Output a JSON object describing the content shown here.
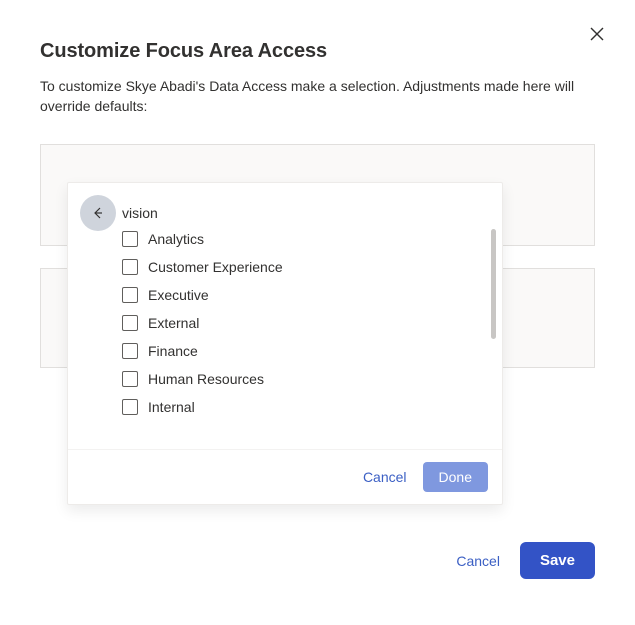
{
  "dialog": {
    "title": "Customize Focus Area Access",
    "subtitle": "To customize Skye Abadi's Data Access make a selection. Adjustments made here will override defaults:",
    "cancel_label": "Cancel",
    "save_label": "Save"
  },
  "popover": {
    "group_label_fragment": "vision",
    "options": [
      {
        "label": "Analytics",
        "checked": false
      },
      {
        "label": "Customer Experience",
        "checked": false
      },
      {
        "label": "Executive",
        "checked": false
      },
      {
        "label": "External",
        "checked": false
      },
      {
        "label": "Finance",
        "checked": false
      },
      {
        "label": "Human Resources",
        "checked": false
      },
      {
        "label": "Internal",
        "checked": false
      }
    ],
    "cancel_label": "Cancel",
    "done_label": "Done"
  }
}
